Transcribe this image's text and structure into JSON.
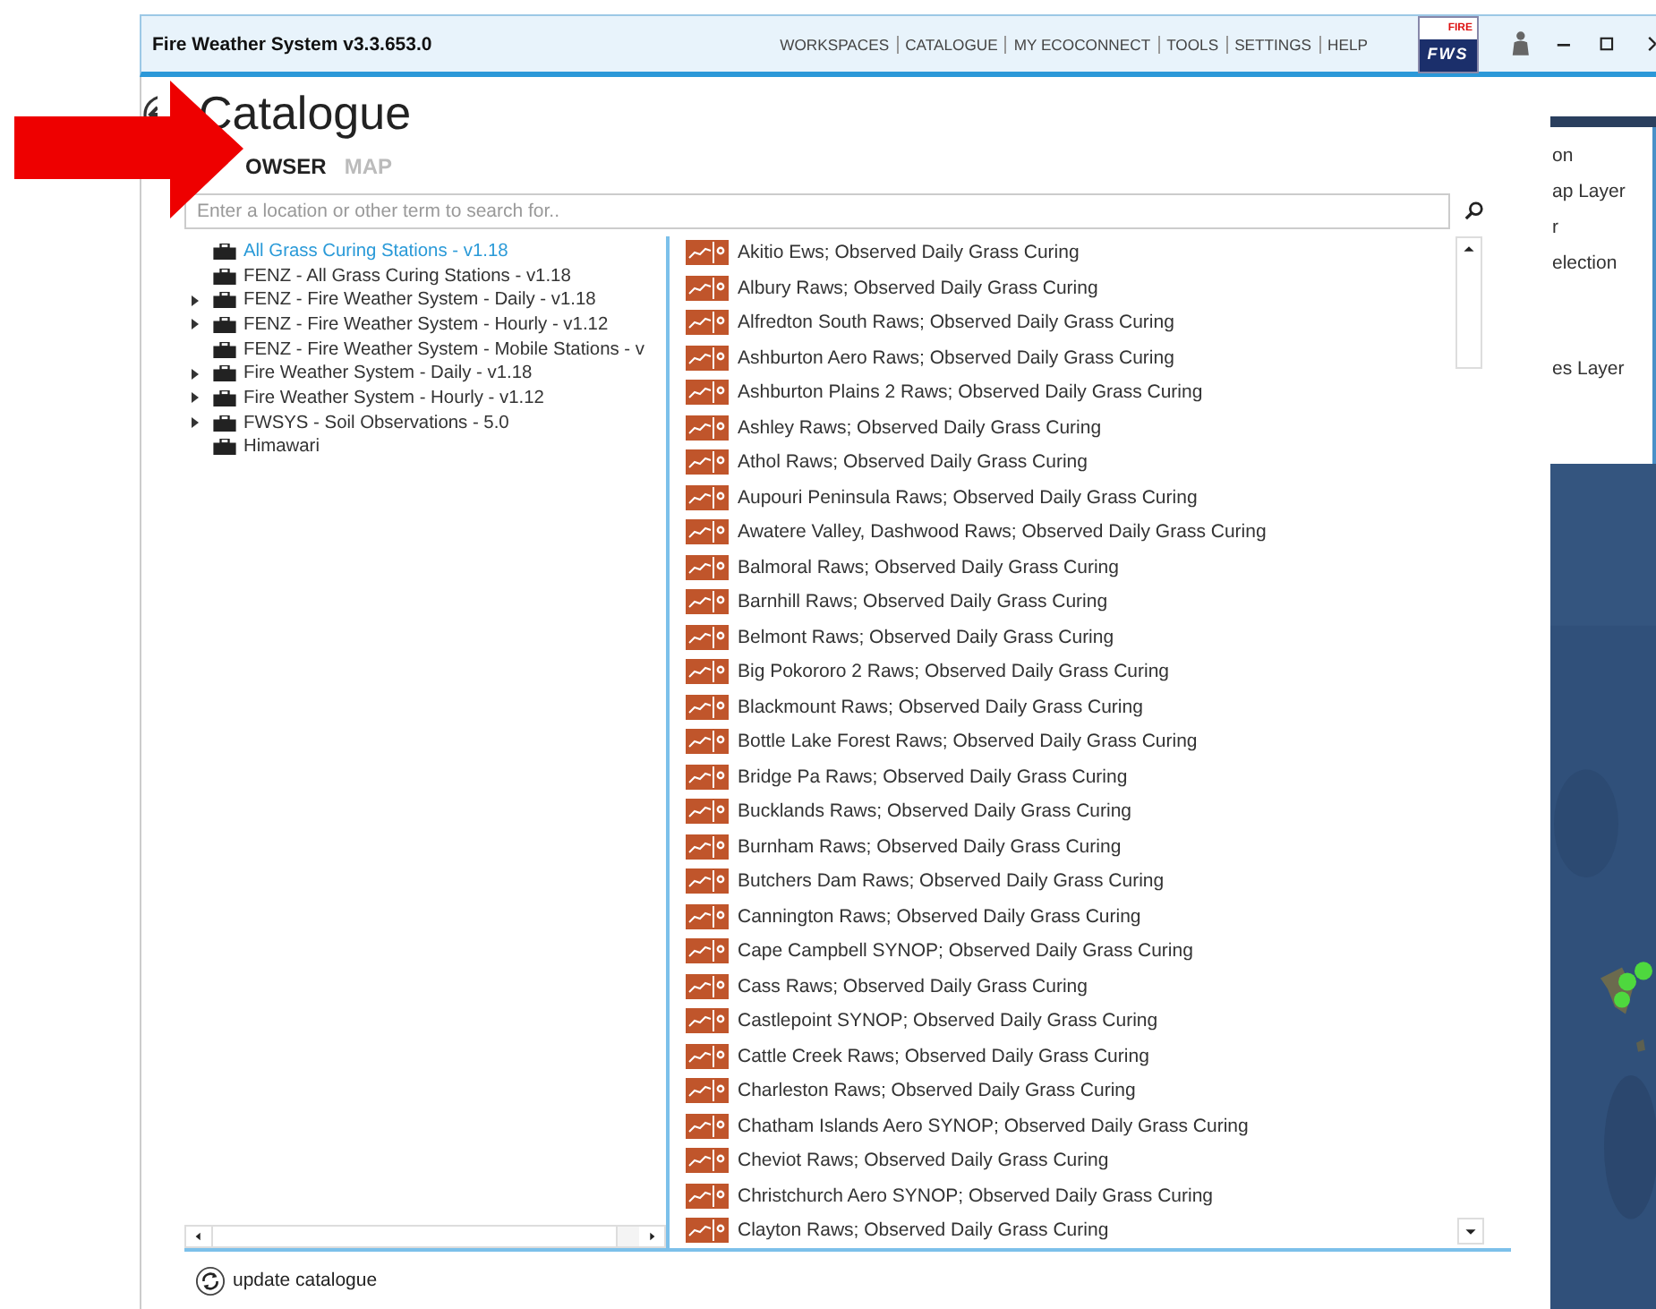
{
  "window": {
    "title": "Fire Weather System v3.3.653.0"
  },
  "menu": [
    "WORKSPACES",
    "CATALOGUE",
    "MY ECOCONNECT",
    "TOOLS",
    "SETTINGS",
    "HELP"
  ],
  "logo": {
    "top": "FIRE",
    "bottom": "FWS"
  },
  "page_title": "Catalogue",
  "tabs": [
    {
      "label": "OWSER",
      "selected": true
    },
    {
      "label": "MAP",
      "selected": false
    }
  ],
  "search": {
    "placeholder": "Enter a location or other term to search for.."
  },
  "tree": [
    {
      "label": "All Grass Curing Stations - v1.18",
      "expandable": false,
      "selected": true
    },
    {
      "label": "FENZ - All Grass Curing Stations - v1.18",
      "expandable": false,
      "selected": false
    },
    {
      "label": "FENZ - Fire Weather System - Daily - v1.18",
      "expandable": true,
      "selected": false
    },
    {
      "label": "FENZ - Fire Weather System - Hourly - v1.12",
      "expandable": true,
      "selected": false
    },
    {
      "label": "FENZ - Fire Weather System - Mobile Stations - v",
      "expandable": false,
      "selected": false
    },
    {
      "label": "Fire Weather System - Daily - v1.18",
      "expandable": true,
      "selected": false
    },
    {
      "label": "Fire Weather System - Hourly - v1.12",
      "expandable": true,
      "selected": false
    },
    {
      "label": "FWSYS - Soil Observations - 5.0",
      "expandable": true,
      "selected": false
    },
    {
      "label": "Himawari",
      "expandable": false,
      "selected": false
    }
  ],
  "layers": [
    "Akitio Ews; Observed Daily Grass Curing",
    "Albury Raws; Observed Daily Grass Curing",
    "Alfredton South Raws; Observed Daily Grass Curing",
    "Ashburton Aero Raws; Observed Daily Grass Curing",
    "Ashburton Plains 2 Raws; Observed Daily Grass Curing",
    "Ashley Raws; Observed Daily Grass Curing",
    "Athol Raws; Observed Daily Grass Curing",
    "Aupouri Peninsula Raws; Observed Daily Grass Curing",
    "Awatere Valley, Dashwood Raws; Observed Daily Grass Curing",
    "Balmoral Raws; Observed Daily Grass Curing",
    "Barnhill Raws; Observed Daily Grass Curing",
    "Belmont Raws; Observed Daily Grass Curing",
    "Big Pokororo 2 Raws; Observed Daily Grass Curing",
    "Blackmount Raws; Observed Daily Grass Curing",
    "Bottle Lake Forest Raws; Observed Daily Grass Curing",
    "Bridge Pa Raws; Observed Daily Grass Curing",
    "Bucklands Raws; Observed Daily Grass Curing",
    "Burnham Raws; Observed Daily Grass Curing",
    "Butchers Dam Raws; Observed Daily Grass Curing",
    "Cannington Raws; Observed Daily Grass Curing",
    "Cape Campbell SYNOP; Observed Daily Grass Curing",
    "Cass Raws; Observed Daily Grass Curing",
    "Castlepoint SYNOP; Observed Daily Grass Curing",
    "Cattle Creek Raws; Observed Daily Grass Curing",
    "Charleston Raws; Observed Daily Grass Curing",
    "Chatham Islands Aero SYNOP; Observed Daily Grass Curing",
    "Cheviot Raws; Observed Daily Grass Curing",
    "Christchurch Aero SYNOP; Observed Daily Grass Curing",
    "Clayton Raws; Observed Daily Grass Curing"
  ],
  "update_button": "update catalogue",
  "side_panel": [
    "on",
    "ap Layer",
    "r",
    "election",
    "es Layer"
  ]
}
